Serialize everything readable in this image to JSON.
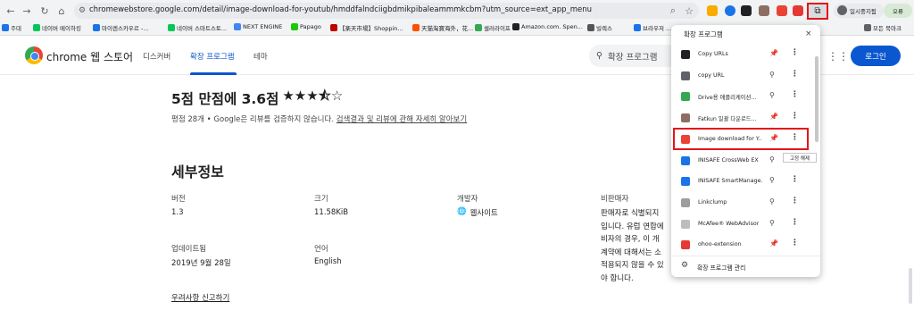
{
  "browser": {
    "url": "chromewebstore.google.com/detail/image-download-for-youtub/hmddfalndciigbdmikpibaleammmkcbm?utm_source=ext_app_menu",
    "profile_label": "일시중지됨",
    "menu_label": "오류"
  },
  "bookmarks": [
    {
      "label": "주대",
      "color": "#1a73e8"
    },
    {
      "label": "네이버 메이하킹",
      "color": "#03c75a"
    },
    {
      "label": "마이렌스카우르 -...",
      "color": "#1a73e8"
    },
    {
      "label": "네이버 스마트스토...",
      "color": "#03c75a"
    },
    {
      "label": "NEXT ENGINE",
      "color": "#4285f4"
    },
    {
      "label": "Papago",
      "color": "#1ec800"
    },
    {
      "label": "【楽天市場】Shoppin...",
      "color": "#bf0000"
    },
    {
      "label": "天猫淘寶海外，花...",
      "color": "#ff5000"
    },
    {
      "label": "셀러라이프",
      "color": "#34a853"
    },
    {
      "label": "Amazon.com. Spen...",
      "color": "#222222"
    },
    {
      "label": "빌렉스",
      "color": "#555555"
    },
    {
      "label": "브라우저 ... 7",
      "color": "#1a73e8"
    },
    {
      "label": "모든 북마크",
      "color": "#5f6368"
    }
  ],
  "store": {
    "brand": "chrome 웹 스토어",
    "tabs": [
      "디스커버",
      "확장 프로그램",
      "테마"
    ],
    "search_placeholder": "확장 프로그램",
    "login": "로그인"
  },
  "rating": {
    "title": "5점 만점에 3.6점",
    "stars": "★★★⯪☆",
    "count": "평점 28개",
    "sep": " • ",
    "notice": "Google은 리뷰를 검증하지 않습니다. ",
    "link": "검색결과 및 리뷰에 관해 자세히 알아보기"
  },
  "details": {
    "title": "세부정보",
    "version_label": "버전",
    "version": "1.3",
    "size_label": "크기",
    "size": "11.58KiB",
    "developer_label": "개발자",
    "developer": "웹사이트",
    "trader_label": "비판매자",
    "trader_text": [
      "판매자로 식별되지",
      "입니다. 유럽 연합에",
      "비자의 경우, 이 개",
      "계약에 대해서는 소",
      "적용되지 않을 수 있",
      "야 합니다."
    ],
    "updated_label": "업데이트됨",
    "updated": "2019년 9월 28일",
    "language_label": "언어",
    "language": "English",
    "report": "우려사항 신고하기"
  },
  "popup": {
    "title": "확장 프로그램",
    "close": "×",
    "tooltip": "고정 해제",
    "manage": "확장 프로그램 관리",
    "items": [
      {
        "name": "Copy URLs",
        "color": "#202124",
        "pinned": true
      },
      {
        "name": "copy URL",
        "color": "#5f6368",
        "pinned": false
      },
      {
        "name": "Drive용 애플리케이션...",
        "color": "#34a853",
        "pinned": false
      },
      {
        "name": "Fatkun 일괄 다운로드...",
        "color": "#8d6e63",
        "pinned": true
      },
      {
        "name": "Image download for Y...",
        "color": "#ea4335",
        "pinned": true
      },
      {
        "name": "INISAFE CrossWeb EX",
        "color": "#1a73e8",
        "pinned": false
      },
      {
        "name": "INISAFE SmartManage...",
        "color": "#1a73e8",
        "pinned": false
      },
      {
        "name": "Linkclump",
        "color": "#9e9e9e",
        "pinned": false
      },
      {
        "name": "McAfee® WebAdvisor",
        "color": "#bdbdbd",
        "pinned": false
      },
      {
        "name": "ohoo-extension",
        "color": "#e53935",
        "pinned": true
      }
    ]
  }
}
